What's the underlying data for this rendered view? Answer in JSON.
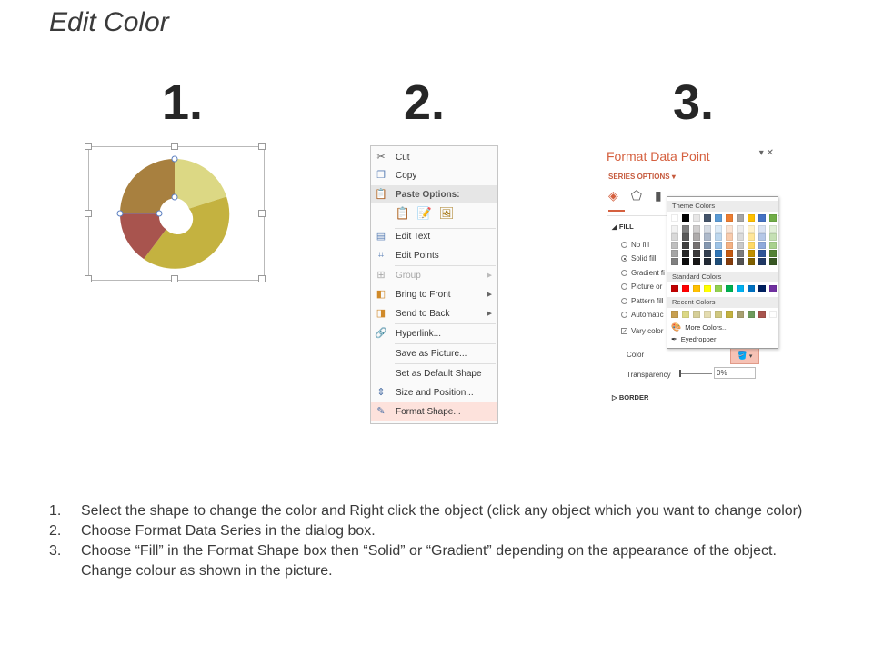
{
  "page": {
    "title": "Edit Color"
  },
  "steps": [
    "1.",
    "2.",
    "3."
  ],
  "donut_colors": [
    "#dcd884",
    "#c4b240",
    "#a8544e",
    "#a8803f"
  ],
  "context_menu": {
    "cut": "Cut",
    "copy": "Copy",
    "paste_options": "Paste Options:",
    "edit_text": "Edit Text",
    "edit_points": "Edit Points",
    "group": "Group",
    "bring_to_front": "Bring to Front",
    "send_to_back": "Send to Back",
    "hyperlink": "Hyperlink...",
    "save_as_picture": "Save as Picture...",
    "set_default_shape": "Set as Default Shape",
    "size_position": "Size and Position...",
    "format_shape": "Format Shape..."
  },
  "format_pane": {
    "title": "Format Data Point",
    "series_options": "SERIES OPTIONS",
    "fill_header": "FILL",
    "no_fill": "No fill",
    "solid_fill": "Solid fill",
    "gradient_fill": "Gradient fi",
    "picture_fill": "Picture or",
    "pattern_fill": "Pattern fill",
    "automatic": "Automatic",
    "vary_colors": "Vary color",
    "color_label": "Color",
    "transparency_label": "Transparency",
    "transparency_value": "0%",
    "border_header": "BORDER"
  },
  "color_picker": {
    "theme_colors": "Theme Colors",
    "standard_colors": "Standard Colors",
    "recent_colors": "Recent Colors",
    "more_colors": "More Colors...",
    "eyedropper": "Eyedropper",
    "theme_top": [
      "#ffffff",
      "#000000",
      "#e7e6e6",
      "#44546a",
      "#5b9bd5",
      "#ed7d31",
      "#a5a5a5",
      "#ffc000",
      "#4472c4",
      "#70ad47"
    ],
    "theme_columns": [
      [
        "#f2f2f2",
        "#d9d9d9",
        "#bfbfbf",
        "#a6a6a6",
        "#808080"
      ],
      [
        "#7f7f7f",
        "#595959",
        "#404040",
        "#262626",
        "#0d0d0d"
      ],
      [
        "#d0cece",
        "#aeabab",
        "#757171",
        "#3a3838",
        "#171616"
      ],
      [
        "#d6dce4",
        "#adb9ca",
        "#8497b0",
        "#333f50",
        "#222a35"
      ],
      [
        "#ddebf7",
        "#bdd7ee",
        "#9dc3e6",
        "#2e75b6",
        "#1f4e79"
      ],
      [
        "#fbe5d6",
        "#f8cbad",
        "#f4b183",
        "#c55a11",
        "#843c0c"
      ],
      [
        "#ededed",
        "#dbdbdb",
        "#c9c9c9",
        "#7b7b7b",
        "#525252"
      ],
      [
        "#fff2cc",
        "#ffe699",
        "#ffd966",
        "#bf9000",
        "#7f6000"
      ],
      [
        "#dae3f3",
        "#b4c7e7",
        "#8faadc",
        "#2f5597",
        "#203864"
      ],
      [
        "#e2f0d9",
        "#c5e0b4",
        "#a9d18e",
        "#548235",
        "#385723"
      ]
    ],
    "standard": [
      "#c00000",
      "#ff0000",
      "#ffc000",
      "#ffff00",
      "#92d050",
      "#00b050",
      "#00b0f0",
      "#0070c0",
      "#002060",
      "#7030a0"
    ],
    "recent": [
      "#c8a050",
      "#dcd884",
      "#d6cf98",
      "#e4dcb0",
      "#d0c880",
      "#c4b240",
      "#a8a070",
      "#6e9a5c",
      "#a8544e",
      "#ffffff"
    ]
  },
  "instructions": [
    {
      "num": "1.",
      "text": "Select the shape to change the color and Right click the object (click any object which you want to change color)"
    },
    {
      "num": "2.",
      "text": "Choose Format Data Series in the dialog box."
    },
    {
      "num": "3.",
      "text": "Choose “Fill” in the Format Shape box then “Solid” or “Gradient” depending on the appearance of the object. Change colour as shown in the picture."
    }
  ]
}
